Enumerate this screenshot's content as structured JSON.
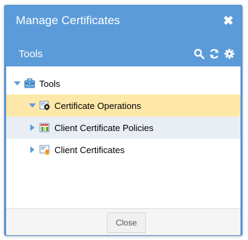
{
  "dialog": {
    "title": "Manage Certificates",
    "close_icon": "close-icon"
  },
  "panel": {
    "title": "Tools",
    "toolbar": [
      {
        "name": "search-icon"
      },
      {
        "name": "refresh-icon"
      },
      {
        "name": "gear-icon"
      }
    ]
  },
  "tree": {
    "root": {
      "label": "Tools",
      "expanded": true,
      "icon": "toolbox-icon"
    },
    "items": [
      {
        "label": "Certificate Operations",
        "expanded": true,
        "selected": true,
        "icon": "certificate-gear-icon"
      },
      {
        "label": "Client Certificate Policies",
        "expanded": false,
        "hover": true,
        "icon": "certificate-policy-icon"
      },
      {
        "label": "Client Certificates",
        "expanded": false,
        "icon": "certificate-icon"
      }
    ]
  },
  "footer": {
    "close_label": "Close"
  },
  "colors": {
    "header": "#5b9bd9",
    "selected_row": "#fde8a9",
    "hover_row": "#e9eef4",
    "tree_arrow": "#5b9bd9"
  }
}
